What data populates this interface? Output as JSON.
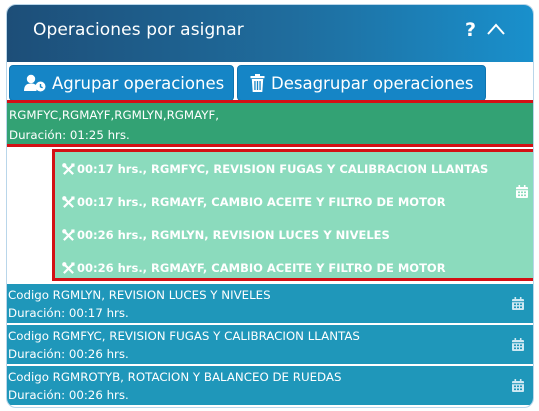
{
  "header": {
    "title": "Operaciones por asignar",
    "help": "?"
  },
  "toolbar": {
    "group_label": "Agrupar operaciones",
    "ungroup_label": "Desagrupar operaciones"
  },
  "selected_group": {
    "codes": "RGMFYC,RGMAYF,RGMLYN,RGMAYF,",
    "duration": "Duración: 01:25 hrs."
  },
  "grouped_operations": [
    {
      "label": "00:17 hrs., RGMFYC, REVISION FUGAS Y CALIBRACION LLANTAS"
    },
    {
      "label": "00:17 hrs., RGMAYF, CAMBIO ACEITE Y FILTRO DE MOTOR"
    },
    {
      "label": "00:26 hrs., RGMLYN, REVISION LUCES Y NIVELES"
    },
    {
      "label": "00:26 hrs., RGMAYF, CAMBIO ACEITE Y FILTRO DE MOTOR"
    }
  ],
  "items": [
    {
      "line1": "Codigo RGMLYN, REVISION LUCES Y NIVELES",
      "line2": "Duración: 00:17 hrs."
    },
    {
      "line1": "Codigo RGMFYC, REVISION FUGAS Y CALIBRACION LLANTAS",
      "line2": "Duración: 00:26 hrs."
    },
    {
      "line1": "Codigo RGMROTYB, ROTACION Y BALANCEO DE RUEDAS",
      "line2": "Duración: 00:26 hrs."
    }
  ],
  "icons": {
    "group_button": "user-clock-icon",
    "ungroup_button": "trash-icon",
    "operation": "wrench-screwdriver-icon",
    "schedule": "calendar-icon",
    "collapse": "chevron-up-icon"
  },
  "colors": {
    "header_start": "#1d4e78",
    "header_end": "#1990cc",
    "button": "#1585c6",
    "selected_group": "#33a274",
    "grouped_ops": "#8bdbbd",
    "highlight_border": "#d31015",
    "item": "#1f97ba"
  }
}
